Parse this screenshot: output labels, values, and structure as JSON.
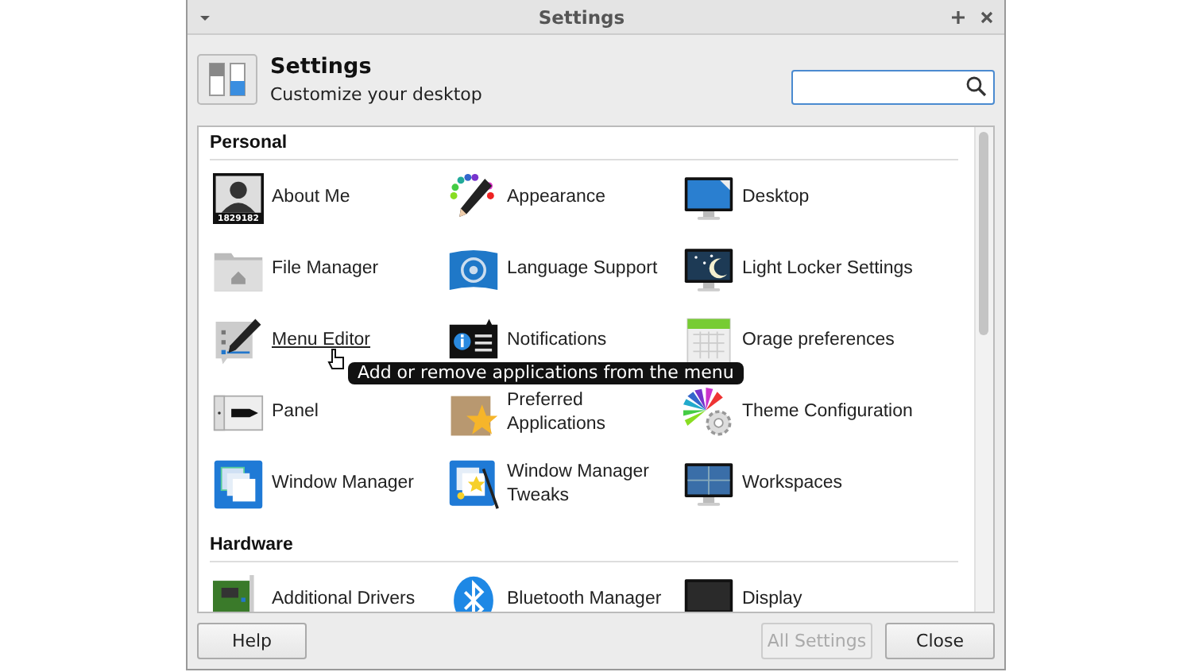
{
  "window": {
    "title": "Settings"
  },
  "header": {
    "title": "Settings",
    "subtitle": "Customize your desktop"
  },
  "sections": [
    {
      "title": "Personal",
      "items": [
        {
          "label": "About Me",
          "hovered": false,
          "icon_text": "1829182"
        },
        {
          "label": "Appearance",
          "hovered": false
        },
        {
          "label": "Desktop",
          "hovered": false
        },
        {
          "label": "File Manager",
          "hovered": false
        },
        {
          "label": "Language Support",
          "hovered": false
        },
        {
          "label": "Light Locker Settings",
          "hovered": false
        },
        {
          "label": "Menu Editor",
          "hovered": true
        },
        {
          "label": "Notifications",
          "hovered": false
        },
        {
          "label": "Orage preferences",
          "hovered": false
        },
        {
          "label": "Panel",
          "hovered": false
        },
        {
          "label": "Preferred Applications",
          "hovered": false
        },
        {
          "label": "Theme Configuration",
          "hovered": false
        },
        {
          "label": "Window Manager",
          "hovered": false
        },
        {
          "label": "Window Manager Tweaks",
          "hovered": false
        },
        {
          "label": "Workspaces",
          "hovered": false
        }
      ]
    },
    {
      "title": "Hardware",
      "items": [
        {
          "label": "Additional Drivers",
          "hovered": false
        },
        {
          "label": "Bluetooth Manager",
          "hovered": false
        },
        {
          "label": "Display",
          "hovered": false
        }
      ]
    }
  ],
  "tooltip": "Add or remove applications from the menu",
  "buttons": [
    {
      "label": "Help",
      "disabled": false
    },
    {
      "label": "All Settings",
      "disabled": true
    },
    {
      "label": "Close",
      "disabled": false
    }
  ]
}
